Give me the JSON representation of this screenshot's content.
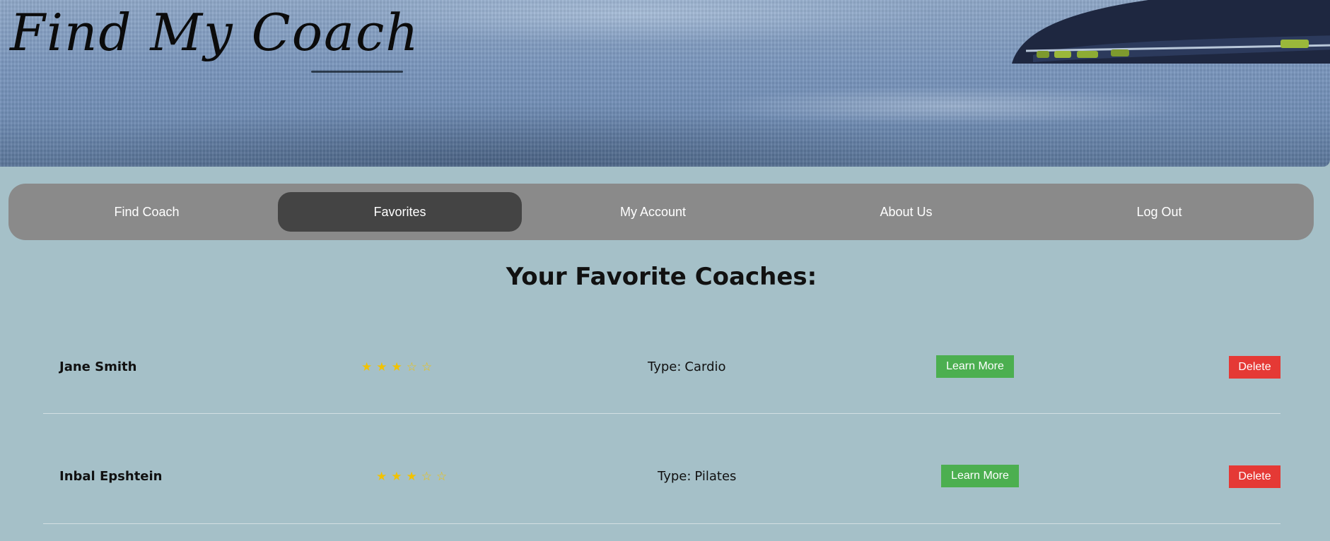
{
  "header": {
    "title": "Find My Coach"
  },
  "nav": {
    "items": [
      {
        "label": "Find Coach",
        "active": false
      },
      {
        "label": "Favorites",
        "active": true
      },
      {
        "label": "My Account",
        "active": false
      },
      {
        "label": "About Us",
        "active": false
      },
      {
        "label": "Log Out",
        "active": false
      }
    ]
  },
  "main": {
    "heading": "Your Favorite Coaches:",
    "coaches": [
      {
        "name": "Jane Smith",
        "rating": 3,
        "rating_max": 5,
        "type_label": "Type:",
        "type": "Cardio",
        "learn_more_label": "Learn More",
        "delete_label": "Delete"
      },
      {
        "name": "Inbal Epshtein",
        "rating": 3,
        "rating_max": 5,
        "type_label": "Type:",
        "type": "Pilates",
        "learn_more_label": "Learn More",
        "delete_label": "Delete"
      }
    ]
  },
  "icons": {
    "star_filled": "star-filled-icon",
    "star_empty": "star-empty-icon"
  },
  "colors": {
    "page_background": "#a5c0c8",
    "nav_background": "#8a8a8a",
    "nav_active": "#444444",
    "star": "#f2c200",
    "learn_more": "#4caf50",
    "delete": "#e53935"
  }
}
